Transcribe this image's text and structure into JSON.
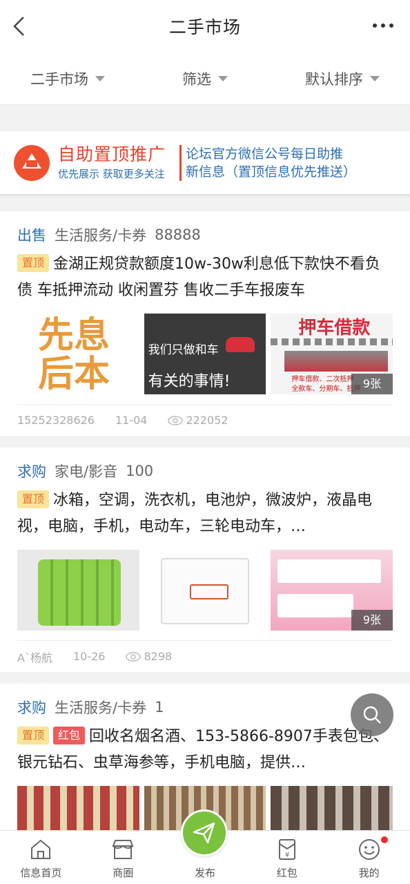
{
  "header": {
    "title": "二手市场"
  },
  "filters": [
    {
      "label": "二手市场"
    },
    {
      "label": "筛选"
    },
    {
      "label": "默认排序"
    }
  ],
  "banner": {
    "headline": "自助置顶推广",
    "subline": "优先展示  获取更多关注",
    "right_line1": "论坛官方微信公号每日助推",
    "right_line2": "新信息（置顶信息优先推送）"
  },
  "posts": [
    {
      "type": "出售",
      "category": "生活服务/卡券",
      "price": "88888",
      "tags": [
        "置顶"
      ],
      "text": "金湖正规贷款额度10w-30w利息低下款快不看负债 车抵押流动 收闲置芬 售收二手车报废车",
      "thumb_texts": [
        "先息",
        "后本",
        "我们只做和车",
        "有关的事情!",
        "押车借款",
        "押车借款、二次抵押",
        "全款车、分期车、抵押"
      ],
      "photo_count": "9张",
      "author": "15252328626",
      "date": "11-04",
      "views": "222052"
    },
    {
      "type": "求购",
      "category": "家电/影音",
      "price": "100",
      "tags": [
        "置顶"
      ],
      "text": "冰箱，空调，洗衣机，电池炉，微波炉，液晶电视，电脑，手机，电动车，三轮电动车，…",
      "photo_count": "9张",
      "author": "A`杨航",
      "date": "10-26",
      "views": "8298"
    },
    {
      "type": "求购",
      "category": "生活服务/卡券",
      "price": "1",
      "tags": [
        "置顶",
        "红包"
      ],
      "text": "回收名烟名酒、153-5866-8907手表包包、银元钻石、虫草海参等，手机电脑，提供…"
    }
  ],
  "bottom_nav": [
    {
      "label": "信息首页"
    },
    {
      "label": "商圈"
    },
    {
      "label": "发布"
    },
    {
      "label": "红包"
    },
    {
      "label": "我的"
    }
  ],
  "colors": {
    "accent_blue": "#2d6fb5",
    "accent_red": "#e8422a",
    "publish_green": "#7ac13e"
  }
}
